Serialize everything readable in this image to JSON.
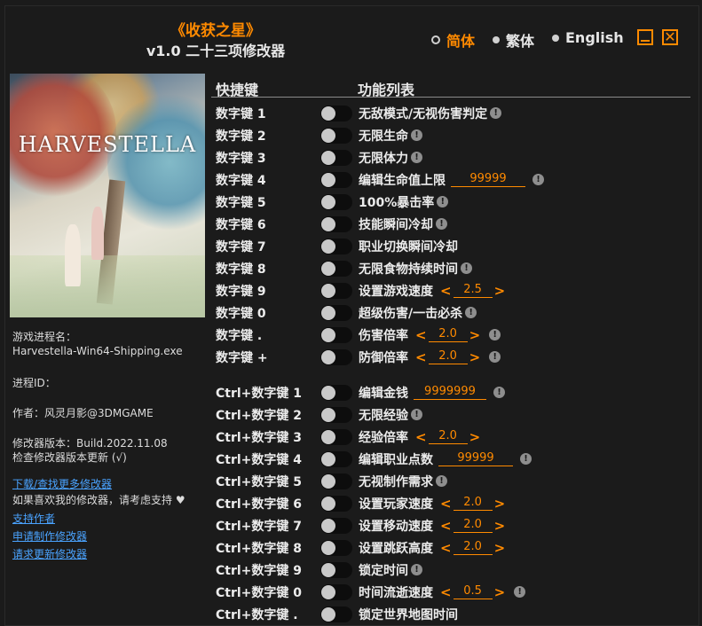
{
  "window": {
    "game_title": "《收获之星》",
    "version_title": "v1.0 二十三项修改器",
    "languages": [
      {
        "label": "简体",
        "active": true
      },
      {
        "label": "繁体",
        "active": false
      },
      {
        "label": "English",
        "active": false
      }
    ],
    "minimize_icon": "minimize-icon",
    "close_icon": "close-icon",
    "close_glyph": "✕"
  },
  "cover": {
    "logo_text": "HARVESTELLA"
  },
  "info": {
    "process_label": "游戏进程名：",
    "process_name": "Harvestella-Win64-Shipping.exe",
    "pid_label": "进程ID：",
    "author": "作者：风灵月影@3DMGAME",
    "build": "修改器版本：Build.2022.11.08",
    "check_update": "检查修改器版本更新 (√)",
    "download_link": "下载/查找更多修改器",
    "support_text": "如果喜欢我的修改器，请考虑支持 ♥",
    "support_link": "支持作者",
    "request_link": "申请制作修改器",
    "update_link": "请求更新修改器"
  },
  "table": {
    "col_hotkey": "快捷键",
    "col_function": "功能列表",
    "info_glyph": "!",
    "arrow_left": "<",
    "arrow_right": ">",
    "rows": [
      {
        "key": "数字键 1",
        "fn": "无敌模式/无视伤害判定",
        "info": true
      },
      {
        "key": "数字键 2",
        "fn": "无限生命",
        "info": true
      },
      {
        "key": "数字键 3",
        "fn": "无限体力",
        "info": true
      },
      {
        "key": "数字键 4",
        "fn": "编辑生命值上限",
        "input": "99999",
        "info": true
      },
      {
        "key": "数字键 5",
        "fn": "100%暴击率",
        "info": true
      },
      {
        "key": "数字键 6",
        "fn": "技能瞬间冷却",
        "info": true
      },
      {
        "key": "数字键 7",
        "fn": "职业切换瞬间冷却",
        "info": false
      },
      {
        "key": "数字键 8",
        "fn": "无限食物持续时间",
        "info": true
      },
      {
        "key": "数字键 9",
        "fn": "设置游戏速度",
        "stepper": "2.5",
        "info": false
      },
      {
        "key": "数字键 0",
        "fn": "超级伤害/一击必杀",
        "info": true
      },
      {
        "key": "数字键 .",
        "fn": "伤害倍率",
        "stepper": "2.0",
        "info": true
      },
      {
        "key": "数字键 +",
        "fn": "防御倍率",
        "stepper": "2.0",
        "info": true
      },
      {
        "key": "Ctrl+数字键 1",
        "fn": "编辑金钱",
        "input": "9999999",
        "info": true
      },
      {
        "key": "Ctrl+数字键 2",
        "fn": "无限经验",
        "info": true
      },
      {
        "key": "Ctrl+数字键 3",
        "fn": "经验倍率",
        "stepper": "2.0",
        "info": false
      },
      {
        "key": "Ctrl+数字键 4",
        "fn": "编辑职业点数",
        "input": "99999",
        "info": true
      },
      {
        "key": "Ctrl+数字键 5",
        "fn": "无视制作需求",
        "info": true
      },
      {
        "key": "Ctrl+数字键 6",
        "fn": "设置玩家速度",
        "stepper": "2.0",
        "info": false
      },
      {
        "key": "Ctrl+数字键 7",
        "fn": "设置移动速度",
        "stepper": "2.0",
        "info": false
      },
      {
        "key": "Ctrl+数字键 8",
        "fn": "设置跳跃高度",
        "stepper": "2.0",
        "info": false
      },
      {
        "key": "Ctrl+数字键 9",
        "fn": "锁定时间",
        "info": true
      },
      {
        "key": "Ctrl+数字键 0",
        "fn": "时间流逝速度",
        "stepper": "0.5",
        "info": true
      },
      {
        "key": "Ctrl+数字键 .",
        "fn": "锁定世界地图时间",
        "info": false
      }
    ]
  },
  "colors": {
    "accent": "#ff8a00",
    "background": "#1b1b1b",
    "link": "#4aa3ff"
  }
}
